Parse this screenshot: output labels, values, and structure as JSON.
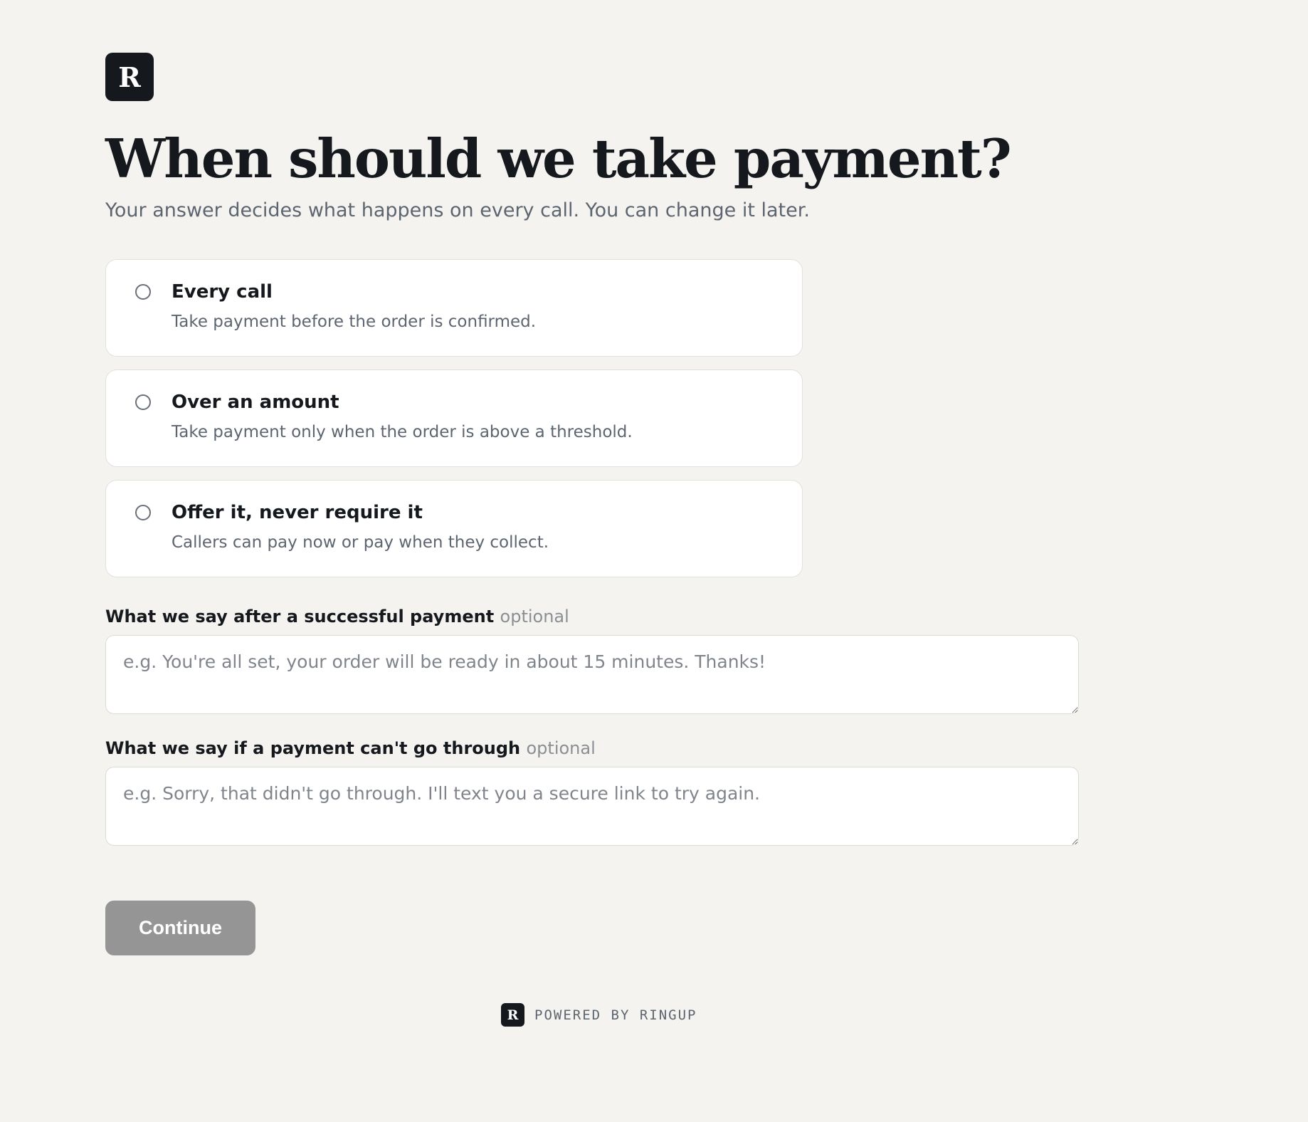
{
  "brand": {
    "logo_letter": "R"
  },
  "header": {
    "title": "When should we take payment?",
    "subtitle": "Your answer decides what happens on every call. You can change it later."
  },
  "options": [
    {
      "title": "Every call",
      "description": "Take payment before the order is confirmed.",
      "selected": false
    },
    {
      "title": "Over an amount",
      "description": "Take payment only when the order is above a threshold.",
      "selected": false
    },
    {
      "title": "Offer it, never require it",
      "description": "Callers can pay now or pay when they collect.",
      "selected": false
    }
  ],
  "fields": {
    "success_message": {
      "label": "What we say after a successful payment",
      "optional_tag": "optional",
      "value": "",
      "placeholder": "e.g. You're all set, your order will be ready in about 15 minutes. Thanks!"
    },
    "failure_message": {
      "label": "What we say if a payment can't go through",
      "optional_tag": "optional",
      "value": "",
      "placeholder": "e.g. Sorry, that didn't go through. I'll text you a secure link to try again."
    }
  },
  "actions": {
    "continue_label": "Continue",
    "continue_disabled": true
  },
  "footer": {
    "logo_letter": "R",
    "text": "POWERED BY RINGUP"
  },
  "colors": {
    "background": "#f4f3ef",
    "text_primary": "#15191e",
    "text_secondary": "#5d6570",
    "button_disabled": "#959595"
  }
}
